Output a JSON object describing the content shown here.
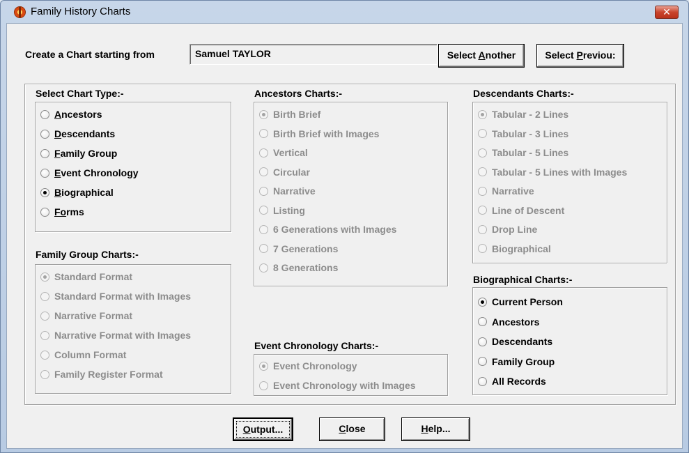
{
  "window": {
    "title": "Family History Charts",
    "close_glyph": "✕"
  },
  "header": {
    "start_label": "Create a Chart starting from",
    "person_value": "Samuel TAYLOR",
    "select_another": {
      "pre": "Select ",
      "key": "A",
      "post": "nother"
    },
    "select_previous": {
      "pre": "Select ",
      "key": "P",
      "post": "reviou:"
    }
  },
  "chart_type": {
    "heading": "Select Chart Type:-",
    "options": [
      {
        "key": "A",
        "rest": "ncestors",
        "checked": false
      },
      {
        "key": "D",
        "rest": "escendants",
        "checked": false
      },
      {
        "key": "F",
        "rest": "amily Group",
        "checked": false
      },
      {
        "key": "E",
        "rest": "vent Chronology",
        "checked": false
      },
      {
        "key": "B",
        "rest": "iographical",
        "checked": true
      },
      {
        "key": "Fo",
        "rest": "rms",
        "checked": false
      }
    ]
  },
  "family_group": {
    "heading": "Family Group Charts:-",
    "options": [
      {
        "label": "Standard Format",
        "checked": true
      },
      {
        "label": "Standard Format with Images",
        "checked": false
      },
      {
        "label": "Narrative Format",
        "checked": false
      },
      {
        "label": "Narrative Format with Images",
        "checked": false
      },
      {
        "label": "Column Format",
        "checked": false
      },
      {
        "label": "Family Register Format",
        "checked": false
      }
    ]
  },
  "ancestors": {
    "heading": "Ancestors Charts:-",
    "options": [
      {
        "label": "Birth Brief",
        "checked": true
      },
      {
        "label": "Birth Brief with Images",
        "checked": false
      },
      {
        "label": "Vertical",
        "checked": false
      },
      {
        "label": "Circular",
        "checked": false
      },
      {
        "label": "Narrative",
        "checked": false
      },
      {
        "label": "Listing",
        "checked": false
      },
      {
        "label": "6 Generations with Images",
        "checked": false
      },
      {
        "label": "7 Generations",
        "checked": false
      },
      {
        "label": "8 Generations",
        "checked": false
      }
    ]
  },
  "event_chronology": {
    "heading": "Event Chronology Charts:-",
    "options": [
      {
        "label": "Event Chronology",
        "checked": true
      },
      {
        "label": "Event Chronology with Images",
        "checked": false
      }
    ]
  },
  "descendants": {
    "heading": "Descendants Charts:-",
    "options": [
      {
        "label": "Tabular - 2 Lines",
        "checked": true
      },
      {
        "label": "Tabular - 3 Lines",
        "checked": false
      },
      {
        "label": "Tabular - 5 Lines",
        "checked": false
      },
      {
        "label": "Tabular - 5 Lines with Images",
        "checked": false
      },
      {
        "label": "Narrative",
        "checked": false
      },
      {
        "label": "Line of Descent",
        "checked": false
      },
      {
        "label": "Drop Line",
        "checked": false
      },
      {
        "label": "Biographical",
        "checked": false
      }
    ]
  },
  "biographical": {
    "heading": "Biographical Charts:-",
    "options": [
      {
        "label": "Current Person",
        "checked": true
      },
      {
        "label": "Ancestors",
        "checked": false
      },
      {
        "label": "Descendants",
        "checked": false
      },
      {
        "label": "Family Group",
        "checked": false
      },
      {
        "label": "All Records",
        "checked": false
      }
    ]
  },
  "footer": {
    "output": {
      "key": "O",
      "rest": "utput..."
    },
    "close": {
      "key": "C",
      "rest": "lose"
    },
    "help": {
      "key": "H",
      "rest": "elp..."
    }
  }
}
